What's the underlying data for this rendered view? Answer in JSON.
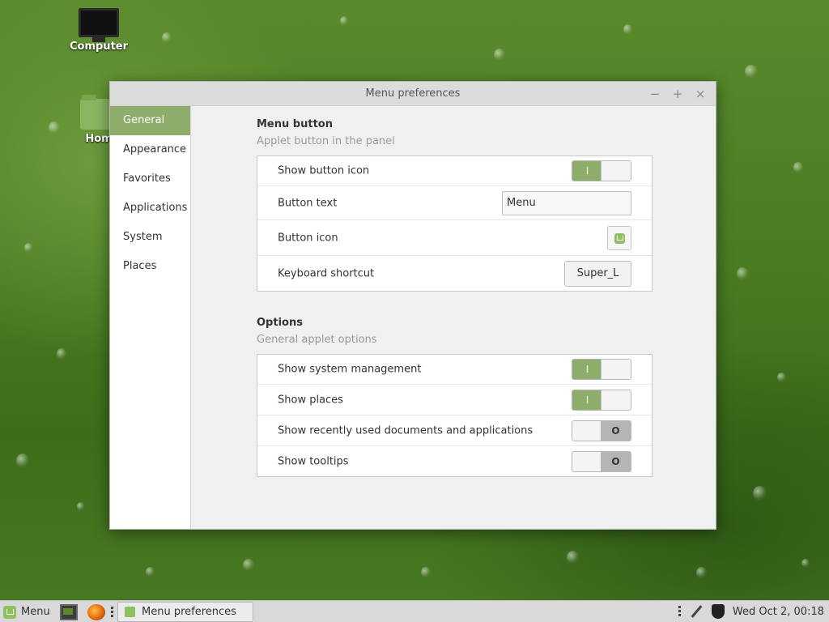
{
  "desktop": {
    "icons": [
      {
        "label": "Computer",
        "icon": "computer-icon"
      },
      {
        "label": "Hom",
        "icon": "home-folder-icon"
      }
    ]
  },
  "window": {
    "title": "Menu preferences",
    "controls": {
      "minimize": "−",
      "maximize": "+",
      "close": "×"
    },
    "sidebar": {
      "items": [
        {
          "label": "General",
          "active": true
        },
        {
          "label": "Appearance",
          "active": false
        },
        {
          "label": "Favorites",
          "active": false
        },
        {
          "label": "Applications",
          "active": false
        },
        {
          "label": "System",
          "active": false
        },
        {
          "label": "Places",
          "active": false
        }
      ]
    },
    "menu_button": {
      "title": "Menu button",
      "subtitle": "Applet button in the panel",
      "rows": {
        "show_button_icon": {
          "label": "Show button icon",
          "value": true,
          "on_glyph": "I"
        },
        "button_text": {
          "label": "Button text",
          "value": "Menu"
        },
        "button_icon": {
          "label": "Button icon",
          "icon": "mint-logo-icon"
        },
        "keyboard_shortcut": {
          "label": "Keyboard shortcut",
          "value": "Super_L"
        }
      }
    },
    "options": {
      "title": "Options",
      "subtitle": "General applet options",
      "rows": {
        "show_system_management": {
          "label": "Show system management",
          "value": true,
          "glyph": "I"
        },
        "show_places": {
          "label": "Show places",
          "value": true,
          "glyph": "I"
        },
        "show_recent": {
          "label": "Show recently used documents and applications",
          "value": false,
          "glyph": "O"
        },
        "show_tooltips": {
          "label": "Show tooltips",
          "value": false,
          "glyph": "O"
        }
      }
    }
  },
  "taskbar": {
    "menu_label": "Menu",
    "task_label": "Menu preferences",
    "clock": "Wed Oct  2, 00:18"
  },
  "colors": {
    "accent": "#8fad6a",
    "window_bg": "#f0f0f0",
    "taskbar_bg": "#d9d9d9"
  }
}
